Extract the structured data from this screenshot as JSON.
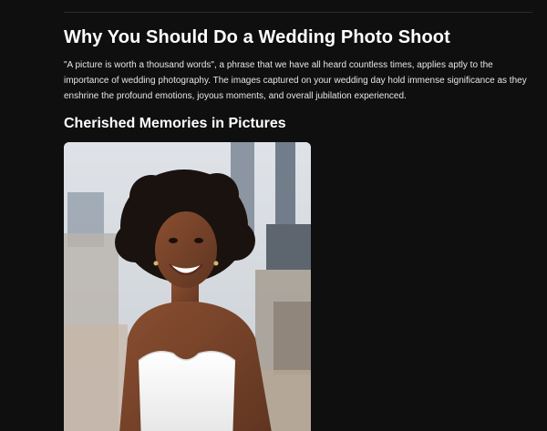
{
  "article": {
    "title": "Why You Should Do a Wedding Photo Shoot",
    "intro": "\"A picture is worth a thousand words\", a phrase that we have all heard countless times, applies aptly to the importance of wedding photography. The images captured on your wedding day hold immense significance as they enshrine the profound emotions, joyous moments, and overall jubilation experienced.",
    "section_heading": "Cherished Memories in Pictures"
  },
  "photo": {
    "subject": "smiling bride in white strapless wedding dress with city skyline background",
    "icon": "photo-image"
  },
  "colors": {
    "background": "#0f0f10",
    "text": "#ffffff",
    "body_text": "#e6e6e6",
    "divider": "#2c2c2e"
  }
}
